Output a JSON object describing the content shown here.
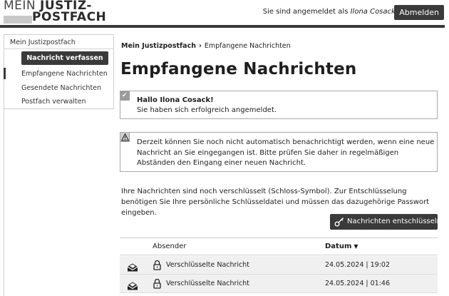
{
  "header": {
    "logo_line1_thin": "MEIN",
    "logo_line1_bold": "JUSTIZ-",
    "logo_line2": "POSTFACH",
    "login_prefix": "Sie sind angemeldet als",
    "login_user": "Ilona Cosack.",
    "logout_label": "Abmelden"
  },
  "sidebar": {
    "title": "Mein Justizpostfach",
    "compose_label": "Nachricht verfassen",
    "items": [
      {
        "label": "Empfangene Nachrichten",
        "active": true
      },
      {
        "label": "Gesendete Nachrichten",
        "active": false
      },
      {
        "label": "Postfach verwalten",
        "active": false
      }
    ]
  },
  "breadcrumb": {
    "root": "Mein Justizpostfach",
    "current": "Empfangene Nachrichten"
  },
  "page_title": "Empfangene Nachrichten",
  "success_alert": {
    "title": "Hallo Ilona Cosack!",
    "text": "Sie haben sich erfolgreich angemeldet."
  },
  "warning_alert": {
    "text": "Derzeit können Sie noch nicht automatisch benachrichtigt werden, wenn eine neue Nachricht an Sie eingegangen ist. Bitte prüfen Sie daher in regelmäßigen Abständen den Eingang einer neuen Nachricht."
  },
  "info_text": "Ihre Nachrichten sind noch verschlüsselt (Schloss-Symbol). Zur Entschlüsselung benötigen Sie Ihre persönliche Schlüsseldatei und müssen das dazugehörige Passwort eingeben.",
  "decrypt_label": "Nachrichten entschlüsseln",
  "table": {
    "col_sender": "Absender",
    "col_date": "Datum",
    "rows": [
      {
        "sender": "Verschlüsselte Nachricht",
        "date": "24.05.2024 | 19:02"
      },
      {
        "sender": "Verschlüsselte Nachricht",
        "date": "24.05.2024 | 01:46"
      }
    ]
  }
}
